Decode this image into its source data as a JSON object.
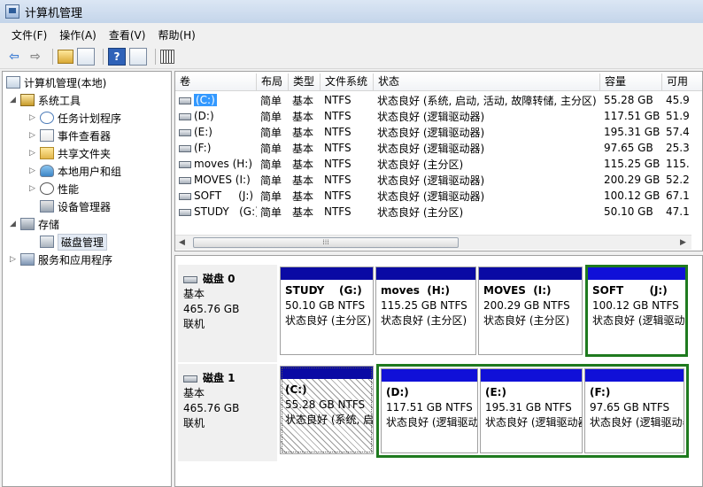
{
  "window": {
    "title": "计算机管理"
  },
  "menu": [
    "文件(F)",
    "操作(A)",
    "查看(V)",
    "帮助(H)"
  ],
  "toolbar": {
    "help_label": "?"
  },
  "tree": {
    "root": "计算机管理(本地)",
    "system_tools": "系统工具",
    "items": [
      "任务计划程序",
      "事件查看器",
      "共享文件夹",
      "本地用户和组",
      "性能",
      "设备管理器"
    ],
    "storage": "存储",
    "disk_management": "磁盘管理",
    "services": "服务和应用程序"
  },
  "table": {
    "columns": [
      "卷",
      "布局",
      "类型",
      "文件系统",
      "状态",
      "容量",
      "可用"
    ],
    "rows": [
      {
        "volume": "(C:)",
        "layout": "简单",
        "type": "基本",
        "fs": "NTFS",
        "status": "状态良好 (系统, 启动, 活动, 故障转储, 主分区)",
        "capacity": "55.28 GB",
        "free": "45.9"
      },
      {
        "volume": "(D:)",
        "layout": "简单",
        "type": "基本",
        "fs": "NTFS",
        "status": "状态良好 (逻辑驱动器)",
        "capacity": "117.51 GB",
        "free": "51.9"
      },
      {
        "volume": "(E:)",
        "layout": "简单",
        "type": "基本",
        "fs": "NTFS",
        "status": "状态良好 (逻辑驱动器)",
        "capacity": "195.31 GB",
        "free": "57.4"
      },
      {
        "volume": "(F:)",
        "layout": "简单",
        "type": "基本",
        "fs": "NTFS",
        "status": "状态良好 (逻辑驱动器)",
        "capacity": "97.65 GB",
        "free": "25.3"
      },
      {
        "volume": "moves (H:)",
        "layout": "简单",
        "type": "基本",
        "fs": "NTFS",
        "status": "状态良好 (主分区)",
        "capacity": "115.25 GB",
        "free": "115."
      },
      {
        "volume": "MOVES (I:)",
        "layout": "简单",
        "type": "基本",
        "fs": "NTFS",
        "status": "状态良好 (逻辑驱动器)",
        "capacity": "200.29 GB",
        "free": "52.2"
      },
      {
        "volume": "SOFT     (J:)",
        "layout": "简单",
        "type": "基本",
        "fs": "NTFS",
        "status": "状态良好 (逻辑驱动器)",
        "capacity": "100.12 GB",
        "free": "67.1"
      },
      {
        "volume": "STUDY   (G:)",
        "layout": "简单",
        "type": "基本",
        "fs": "NTFS",
        "status": "状态良好 (主分区)",
        "capacity": "50.10 GB",
        "free": "47.1"
      }
    ]
  },
  "disks": [
    {
      "name": "磁盘 0",
      "type": "基本",
      "size": "465.76 GB",
      "state": "联机",
      "partitions": [
        {
          "name": "STUDY    (G:)",
          "size": "50.10 GB NTFS",
          "status": "状态良好 (主分区)"
        },
        {
          "name": "moves  (H:)",
          "size": "115.25 GB NTFS",
          "status": "状态良好 (主分区)"
        },
        {
          "name": "MOVES  (I:)",
          "size": "200.29 GB NTFS",
          "status": "状态良好 (主分区)"
        },
        {
          "name": "SOFT       (J:)",
          "size": "100.12 GB NTFS",
          "status": "状态良好 (逻辑驱动器)"
        }
      ]
    },
    {
      "name": "磁盘 1",
      "type": "基本",
      "size": "465.76 GB",
      "state": "联机",
      "partitions": [
        {
          "name": "(C:)",
          "size": "55.28 GB NTFS",
          "status": "状态良好 (系统, 启动"
        },
        {
          "name": "(D:)",
          "size": "117.51 GB NTFS",
          "status": "状态良好 (逻辑驱动器)"
        },
        {
          "name": "(E:)",
          "size": "195.31 GB NTFS",
          "status": "状态良好 (逻辑驱动器)"
        },
        {
          "name": "(F:)",
          "size": "97.65 GB NTFS",
          "status": "状态良好 (逻辑驱动器)"
        }
      ]
    }
  ]
}
